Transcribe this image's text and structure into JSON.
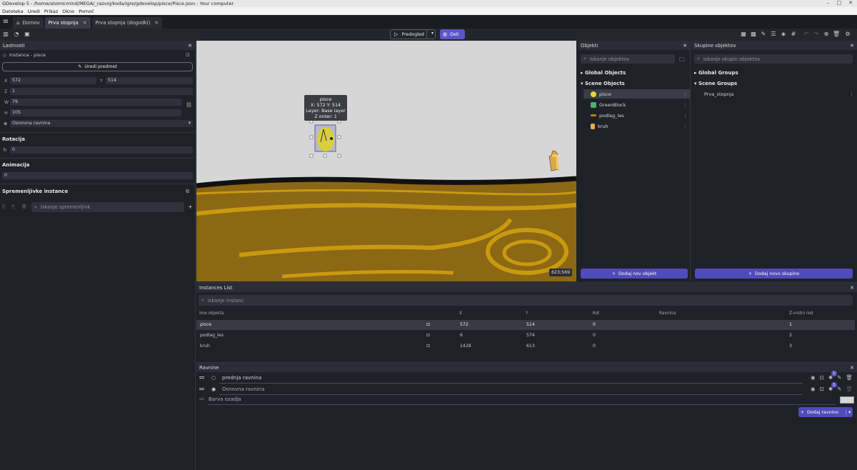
{
  "window": {
    "title": "GDevelop 5 - /home/atomicmind/MEGA/_razvoj/koda/igre/gdevelop/pisce/Pisce.json - Your computer"
  },
  "menu": [
    "Datoteka",
    "Uredi",
    "Prikaz",
    "Okno",
    "Pomoč"
  ],
  "tabs": [
    {
      "label": "Domov"
    },
    {
      "label": "Prva stopnja"
    },
    {
      "label": "Prva stopnja (dogodki)"
    }
  ],
  "toolbar": {
    "preview_label": "Predogled",
    "share_label": "Deli"
  },
  "properties": {
    "title": "Lastnosti",
    "instance_label": "Instanca - pisce",
    "edit_button": "Uredi predmet",
    "x_label": "X",
    "x_value": "572",
    "y_label": "Y",
    "y_value": "514",
    "z_label": "Z",
    "z_value": "1",
    "w_label": "W",
    "w_value": "79",
    "h_label": "H",
    "h_value": "105",
    "layer_value": "Osnovna ravnina",
    "rotation_title": "Rotacija",
    "rotation_value": "0",
    "animation_title": "Animacija",
    "animation_value": "0",
    "variables_title": "Spremenljivke instance",
    "variables_search_placeholder": "Iskanje spremenljivk"
  },
  "canvas": {
    "tooltip": {
      "name": "pisce",
      "coords": "X: 572  Y: 514",
      "layer": "Layer: Base layer",
      "zorder": "Z order: 1"
    },
    "coord_readout": "623;569",
    "colors": {
      "sky": "#d6d6d6",
      "ground": "#8c6714",
      "stripe": "#c99a10",
      "bird": "#d8cf3a"
    }
  },
  "objects": {
    "title": "Objekti",
    "search_placeholder": "Iskanje objektov",
    "global_header": "Global Objects",
    "scene_header": "Scene Objects",
    "items": [
      {
        "name": "pisce",
        "icon": "bird-icon"
      },
      {
        "name": "GreenBlock",
        "icon": "green-block-icon"
      },
      {
        "name": "podlag_les",
        "icon": "wood-ground-icon"
      },
      {
        "name": "kruh",
        "icon": "bread-icon"
      }
    ],
    "add_button": "Dodaj nov objekt"
  },
  "groups": {
    "title": "Skupine objektov",
    "search_placeholder": "Iskanje skupin objektov",
    "global_header": "Global Groups",
    "scene_header": "Scene Groups",
    "items": [
      "Prva_stopnja"
    ],
    "add_button": "Dodaj novo skupino"
  },
  "instances": {
    "title": "Instances List",
    "search_placeholder": "Iskanje instanc",
    "columns": {
      "name": "Ime objekta",
      "x": "X",
      "y": "Y",
      "angle": "Kot",
      "layer": "Ravnina",
      "zorder": "Z-vrstni red"
    },
    "rows": [
      {
        "name": "pisce",
        "x": "572",
        "y": "514",
        "angle": "0",
        "layer": "",
        "zorder": "1"
      },
      {
        "name": "podlag_les",
        "x": "6",
        "y": "574",
        "angle": "0",
        "layer": "",
        "zorder": "2"
      },
      {
        "name": "kruh",
        "x": "1428",
        "y": "613",
        "angle": "0",
        "layer": "",
        "zorder": "3"
      }
    ]
  },
  "layers": {
    "title": "Ravnine",
    "items": [
      {
        "name": "prednja ravnina",
        "badge": "1"
      },
      {
        "name": "Osnovna ravnina",
        "badge": "1"
      }
    ],
    "background_label": "Barva ozadja",
    "add_button": "Dodaj ravnino"
  }
}
